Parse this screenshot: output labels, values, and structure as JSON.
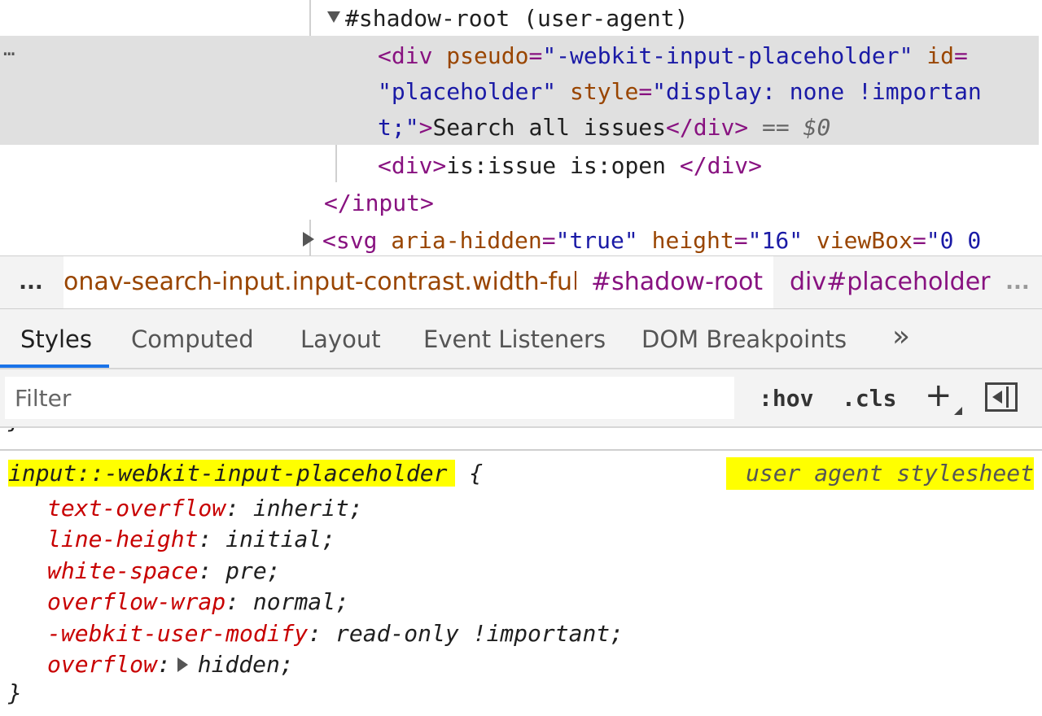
{
  "dom_tree": {
    "shadow_root_label": "#shadow-root (user-agent)",
    "selected_node": {
      "tag_open": "<div",
      "attr1_name": "pseudo",
      "attr1_value": "\"-webkit-input-placeholder\"",
      "attr2_name": "id",
      "attr2_value": "\"placeholder\"",
      "attr3_name": "style",
      "attr3_value_part1": "\"display: none !importan",
      "attr3_value_part2": "t;\"",
      "text": "Search all issues",
      "tag_close": "</div>",
      "selection_marker": "== $0",
      "dots": "…"
    },
    "sibling_node": {
      "tag_open": "<div>",
      "text": "is:issue is:open ",
      "tag_close": "</div>"
    },
    "input_close": "</input>",
    "svg_node": {
      "tag_open": "<svg",
      "attr1_name": "aria-hidden",
      "attr1_value": "\"true\"",
      "attr2_name": "height",
      "attr2_value": "\"16\"",
      "attr3_name": "viewBox",
      "attr3_value": "\"0 0"
    }
  },
  "breadcrumb": {
    "more_left": "...",
    "items": [
      "onav-search-input.input-contrast.width-full",
      "#shadow-root",
      "div#placeholder"
    ],
    "more_right": "..."
  },
  "tabs": [
    {
      "label": "Styles",
      "active": true
    },
    {
      "label": "Computed",
      "active": false
    },
    {
      "label": "Layout",
      "active": false
    },
    {
      "label": "Event Listeners",
      "active": false
    },
    {
      "label": "DOM Breakpoints",
      "active": false
    }
  ],
  "tabs_overflow": "»",
  "filter": {
    "placeholder": "Filter",
    "hov_label": ":hov",
    "cls_label": ".cls",
    "add_label": "+"
  },
  "styles": {
    "prev_rule_close": "}",
    "selector": "input::-webkit-input-placeholder",
    "open_brace": "{",
    "source": "user agent stylesheet",
    "declarations": [
      {
        "prop": "text-overflow",
        "value": "inherit;"
      },
      {
        "prop": "line-height",
        "value": "initial;"
      },
      {
        "prop": "white-space",
        "value": "pre;"
      },
      {
        "prop": "overflow-wrap",
        "value": "normal;"
      },
      {
        "prop": "-webkit-user-modify",
        "value": "read-only !important;"
      },
      {
        "prop": "overflow",
        "value": "hidden;"
      }
    ],
    "close_brace": "}"
  },
  "colors": {
    "tag": "#881280",
    "attribute": "#994500",
    "attr_value": "#1a1aa6",
    "css_property": "#c80000",
    "highlight": "#ffff00",
    "active_tab_underline": "#1a73e8",
    "selected_row_bg": "#e0e0e0"
  }
}
